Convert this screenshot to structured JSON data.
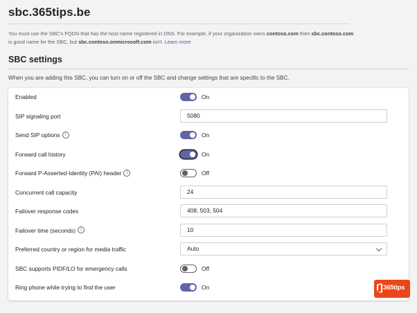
{
  "page": {
    "fqdn_title": "sbc.365tips.be",
    "help": {
      "part1": "You must use the SBC's FQDN that has the host name registered in DNS. For example, if your organization owns ",
      "bold1": "contoso.com",
      "part2": " then ",
      "bold2": "sbc.contoso.com",
      "part3": " is good name for the SBC, but ",
      "bold3": "sbc.contoso.onmicrosoft.com",
      "part4": " isn't. ",
      "learn_more": "Learn more"
    },
    "section_title": "SBC settings",
    "section_desc": "When you are adding this SBC, you can turn on or off the SBC and change settings that are specific to the SBC."
  },
  "settings": [
    {
      "label": "Enabled",
      "type": "toggle",
      "state": "On"
    },
    {
      "label": "SIP signaling port",
      "type": "text",
      "value": "5080"
    },
    {
      "label": "Send SIP options",
      "info": true,
      "type": "toggle",
      "state": "On"
    },
    {
      "label": "Forward call history",
      "type": "toggle",
      "state": "On"
    },
    {
      "label": "Forward P-Asserted-Identity (PAI) header",
      "info": true,
      "type": "toggle",
      "state": "Off"
    },
    {
      "label": "Concurrent call capacity",
      "type": "text",
      "value": "24"
    },
    {
      "label": "Failover response codes",
      "type": "text",
      "value": "408, 503, 504"
    },
    {
      "label": "Failover time (seconds)",
      "info": true,
      "type": "text",
      "value": "10"
    },
    {
      "label": "Preferred country or region for media traffic",
      "type": "select",
      "value": "Auto"
    },
    {
      "label": "SBC supports PIDF/LO for emergency calls",
      "type": "toggle",
      "state": "Off"
    },
    {
      "label": "Ring phone while trying to find the user",
      "type": "toggle",
      "state": "On"
    }
  ],
  "watermark": {
    "text": "365tips",
    "color": "#e8471a"
  },
  "colors": {
    "accent": "#6264a7",
    "background": "#f3f3f3"
  },
  "icons": {
    "info": "info-icon",
    "dropdown": "chevron-down-icon",
    "logo": "office-logo-icon"
  }
}
